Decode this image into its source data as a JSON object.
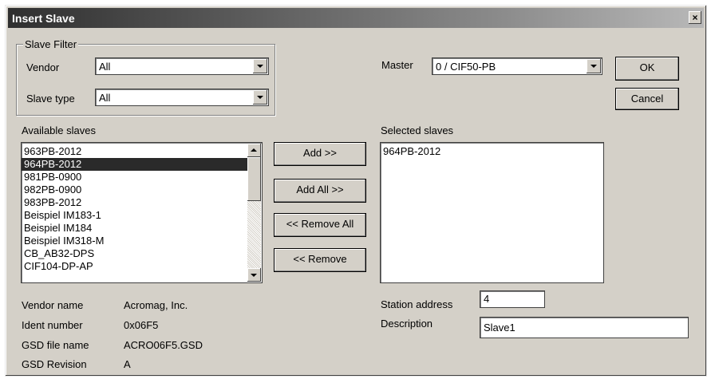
{
  "window": {
    "title": "Insert Slave",
    "close_glyph": "×"
  },
  "filter": {
    "group_label": "Slave Filter",
    "vendor_label": "Vendor",
    "vendor_value": "All",
    "slave_type_label": "Slave type",
    "slave_type_value": "All"
  },
  "master": {
    "label": "Master",
    "value": "0 / CIF50-PB"
  },
  "buttons": {
    "ok": "OK",
    "cancel": "Cancel",
    "add": "Add >>",
    "add_all": "Add All >>",
    "remove_all": "<< Remove All",
    "remove": "<< Remove"
  },
  "available": {
    "label": "Available slaves",
    "items": [
      "963PB-2012",
      "964PB-2012",
      "981PB-0900",
      "982PB-0900",
      "983PB-2012",
      "Beispiel IM183-1",
      "Beispiel IM184",
      "Beispiel IM318-M",
      "CB_AB32-DPS",
      "CIF104-DP-AP"
    ],
    "selected_index": 1
  },
  "selected": {
    "label": "Selected slaves",
    "items": [
      "964PB-2012"
    ]
  },
  "info": {
    "vendor_name_label": "Vendor name",
    "vendor_name_value": "Acromag, Inc.",
    "ident_label": "Ident number",
    "ident_value": "0x06F5",
    "gsd_label": "GSD file name",
    "gsd_value": "ACRO06F5.GSD",
    "rev_label": "GSD Revision",
    "rev_value": "A"
  },
  "station": {
    "label": "Station address",
    "value": "4"
  },
  "description": {
    "label": "Description",
    "value": "Slave1"
  },
  "icons": {
    "close": "close-icon",
    "dropdown": "chevron-down-icon",
    "scroll_up": "arrow-up-icon",
    "scroll_down": "arrow-down-icon"
  }
}
